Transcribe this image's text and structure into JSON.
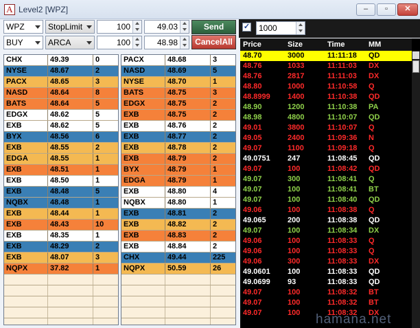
{
  "window": {
    "title": "Level2 [WPZ]"
  },
  "toolbar": {
    "symbol": "WPZ",
    "order_type": "StopLimit",
    "qty1": "100",
    "price1": "49.03",
    "side": "BUY",
    "route": "ARCA",
    "qty2": "100",
    "price2": "48.98",
    "send_label": "Send",
    "cancel_all_label": "CancelAll",
    "ts_checkbox": "✓",
    "ts_size_filter": "1000"
  },
  "colors": {
    "yellow_row": "#f4b952",
    "blue_row": "#3a7fb5",
    "orange_row": "#f5813a",
    "white_row": "#ffffff",
    "empty_row": "#fbf0dc",
    "ts_red": "#ff2a2a",
    "ts_green": "#8fd14a",
    "ts_white": "#ffffff",
    "ts_highlight": "#ffff00"
  },
  "bid": [
    {
      "mm": "CHX",
      "price": "49.39",
      "size": "0",
      "color": "#ffffff"
    },
    {
      "mm": "NYSE",
      "price": "48.67",
      "size": "2",
      "color": "#3a7fb5"
    },
    {
      "mm": "PACX",
      "price": "48.65",
      "size": "3",
      "color": "#f4b952"
    },
    {
      "mm": "NASD",
      "price": "48.64",
      "size": "8",
      "color": "#f5813a"
    },
    {
      "mm": "BATS",
      "price": "48.64",
      "size": "5",
      "color": "#f5813a"
    },
    {
      "mm": "EDGX",
      "price": "48.62",
      "size": "5",
      "color": "#ffffff"
    },
    {
      "mm": "EXB",
      "price": "48.62",
      "size": "5",
      "color": "#ffffff"
    },
    {
      "mm": "BYX",
      "price": "48.56",
      "size": "6",
      "color": "#3a7fb5"
    },
    {
      "mm": "EXB",
      "price": "48.55",
      "size": "2",
      "color": "#f4b952"
    },
    {
      "mm": "EDGA",
      "price": "48.55",
      "size": "1",
      "color": "#f4b952"
    },
    {
      "mm": "EXB",
      "price": "48.51",
      "size": "1",
      "color": "#f5813a"
    },
    {
      "mm": "EXB",
      "price": "48.50",
      "size": "1",
      "color": "#ffffff"
    },
    {
      "mm": "EXB",
      "price": "48.48",
      "size": "5",
      "color": "#3a7fb5"
    },
    {
      "mm": "NQBX",
      "price": "48.48",
      "size": "1",
      "color": "#3a7fb5"
    },
    {
      "mm": "EXB",
      "price": "48.44",
      "size": "1",
      "color": "#f4b952"
    },
    {
      "mm": "EXB",
      "price": "48.43",
      "size": "10",
      "color": "#f5813a"
    },
    {
      "mm": "EXB",
      "price": "48.35",
      "size": "1",
      "color": "#ffffff"
    },
    {
      "mm": "EXB",
      "price": "48.29",
      "size": "2",
      "color": "#3a7fb5"
    },
    {
      "mm": "EXB",
      "price": "48.07",
      "size": "3",
      "color": "#f4b952"
    },
    {
      "mm": "NQPX",
      "price": "37.82",
      "size": "1",
      "color": "#f5813a"
    }
  ],
  "ask": [
    {
      "mm": "PACX",
      "price": "48.68",
      "size": "3",
      "color": "#ffffff"
    },
    {
      "mm": "NASD",
      "price": "48.69",
      "size": "5",
      "color": "#3a7fb5"
    },
    {
      "mm": "NYSE",
      "price": "48.70",
      "size": "1",
      "color": "#f4b952"
    },
    {
      "mm": "BATS",
      "price": "48.75",
      "size": "3",
      "color": "#f5813a"
    },
    {
      "mm": "EDGX",
      "price": "48.75",
      "size": "2",
      "color": "#f5813a"
    },
    {
      "mm": "EXB",
      "price": "48.75",
      "size": "2",
      "color": "#f5813a"
    },
    {
      "mm": "EXB",
      "price": "48.76",
      "size": "2",
      "color": "#ffffff"
    },
    {
      "mm": "EXB",
      "price": "48.77",
      "size": "2",
      "color": "#3a7fb5"
    },
    {
      "mm": "EXB",
      "price": "48.78",
      "size": "2",
      "color": "#f4b952"
    },
    {
      "mm": "EXB",
      "price": "48.79",
      "size": "2",
      "color": "#f5813a"
    },
    {
      "mm": "BYX",
      "price": "48.79",
      "size": "1",
      "color": "#f5813a"
    },
    {
      "mm": "EDGA",
      "price": "48.79",
      "size": "1",
      "color": "#f5813a"
    },
    {
      "mm": "EXB",
      "price": "48.80",
      "size": "4",
      "color": "#ffffff"
    },
    {
      "mm": "NQBX",
      "price": "48.80",
      "size": "1",
      "color": "#ffffff"
    },
    {
      "mm": "EXB",
      "price": "48.81",
      "size": "2",
      "color": "#3a7fb5"
    },
    {
      "mm": "EXB",
      "price": "48.82",
      "size": "2",
      "color": "#f4b952"
    },
    {
      "mm": "EXB",
      "price": "48.83",
      "size": "2",
      "color": "#f5813a"
    },
    {
      "mm": "EXB",
      "price": "48.84",
      "size": "2",
      "color": "#ffffff"
    },
    {
      "mm": "CHX",
      "price": "49.44",
      "size": "225",
      "color": "#3a7fb5"
    },
    {
      "mm": "NQPX",
      "price": "50.59",
      "size": "26",
      "color": "#f4b952"
    }
  ],
  "time_sales": {
    "headers": {
      "price": "Price",
      "size": "Size",
      "time": "Time",
      "mm": "MM"
    },
    "rows": [
      {
        "price": "48.70",
        "size": "3000",
        "time": "11:11:18",
        "mm": "QD",
        "color": "#000000",
        "highlight": true
      },
      {
        "price": "48.76",
        "size": "1033",
        "time": "11:11:03",
        "mm": "DX",
        "color": "#ff2a2a"
      },
      {
        "price": "48.76",
        "size": "2817",
        "time": "11:11:03",
        "mm": "DX",
        "color": "#ff2a2a"
      },
      {
        "price": "48.80",
        "size": "1000",
        "time": "11:10:58",
        "mm": "Q",
        "color": "#ff2a2a"
      },
      {
        "price": "48.8999",
        "size": "1400",
        "time": "11:10:38",
        "mm": "QD",
        "color": "#ff2a2a"
      },
      {
        "price": "48.90",
        "size": "1200",
        "time": "11:10:38",
        "mm": "PA",
        "color": "#8fd14a"
      },
      {
        "price": "48.98",
        "size": "4800",
        "time": "11:10:07",
        "mm": "QD",
        "color": "#8fd14a"
      },
      {
        "price": "49.01",
        "size": "3800",
        "time": "11:10:07",
        "mm": "Q",
        "color": "#ff2a2a"
      },
      {
        "price": "49.05",
        "size": "2400",
        "time": "11:09:36",
        "mm": "N",
        "color": "#ff2a2a"
      },
      {
        "price": "49.07",
        "size": "1100",
        "time": "11:09:18",
        "mm": "Q",
        "color": "#ff2a2a"
      },
      {
        "price": "49.0751",
        "size": "247",
        "time": "11:08:45",
        "mm": "QD",
        "color": "#ffffff"
      },
      {
        "price": "49.07",
        "size": "100",
        "time": "11:08:42",
        "mm": "QD",
        "color": "#ff2a2a"
      },
      {
        "price": "49.07",
        "size": "300",
        "time": "11:08:41",
        "mm": "Q",
        "color": "#8fd14a"
      },
      {
        "price": "49.07",
        "size": "100",
        "time": "11:08:41",
        "mm": "BT",
        "color": "#8fd14a"
      },
      {
        "price": "49.07",
        "size": "100",
        "time": "11:08:40",
        "mm": "QD",
        "color": "#8fd14a"
      },
      {
        "price": "49.06",
        "size": "100",
        "time": "11:08:38",
        "mm": "Q",
        "color": "#ff2a2a"
      },
      {
        "price": "49.065",
        "size": "200",
        "time": "11:08:38",
        "mm": "QD",
        "color": "#ffffff"
      },
      {
        "price": "49.07",
        "size": "100",
        "time": "11:08:34",
        "mm": "DX",
        "color": "#8fd14a"
      },
      {
        "price": "49.06",
        "size": "100",
        "time": "11:08:33",
        "mm": "Q",
        "color": "#ff2a2a"
      },
      {
        "price": "49.06",
        "size": "100",
        "time": "11:08:33",
        "mm": "Q",
        "color": "#ff2a2a"
      },
      {
        "price": "49.06",
        "size": "300",
        "time": "11:08:33",
        "mm": "DX",
        "color": "#ff2a2a"
      },
      {
        "price": "49.0601",
        "size": "100",
        "time": "11:08:33",
        "mm": "QD",
        "color": "#ffffff"
      },
      {
        "price": "49.0699",
        "size": "93",
        "time": "11:08:33",
        "mm": "QD",
        "color": "#ffffff"
      },
      {
        "price": "49.07",
        "size": "100",
        "time": "11:08:32",
        "mm": "BT",
        "color": "#ff2a2a"
      },
      {
        "price": "49.07",
        "size": "100",
        "time": "11:08:32",
        "mm": "BT",
        "color": "#ff2a2a"
      },
      {
        "price": "49.07",
        "size": "100",
        "time": "11:08:32",
        "mm": "DX",
        "color": "#ff2a2a"
      }
    ]
  },
  "watermark": "hamana.net"
}
